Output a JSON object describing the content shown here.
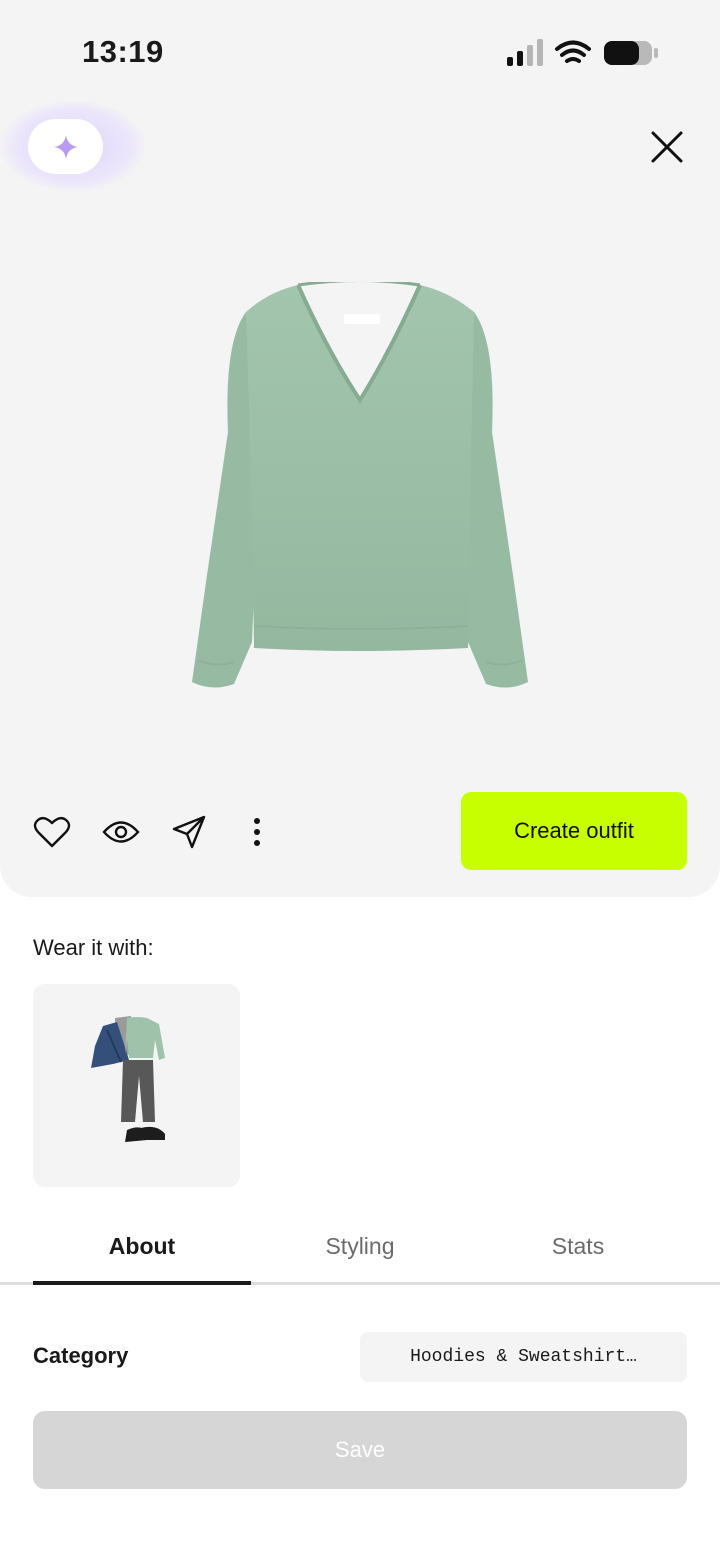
{
  "status_bar": {
    "time": "13:19",
    "icons": [
      "signal-icon",
      "wifi-icon",
      "battery-icon"
    ]
  },
  "header": {
    "ai_button_icon": "sparkle-icon",
    "close_icon": "close-icon"
  },
  "product": {
    "image": "green-v-neck-sweater",
    "color": "#9dbfa8"
  },
  "actions": {
    "icons": [
      "heart-icon",
      "eye-icon",
      "send-icon",
      "more-vertical-icon"
    ],
    "create_outfit_label": "Create outfit",
    "accent_color": "#c8ff00"
  },
  "wear_it_with": {
    "label": "Wear it with:",
    "outfits": [
      {
        "items": [
          "denim-jacket",
          "grey-top",
          "green-sweater",
          "grey-trousers",
          "black-sneakers"
        ]
      }
    ]
  },
  "tabs": [
    {
      "label": "About",
      "active": true
    },
    {
      "label": "Styling",
      "active": false
    },
    {
      "label": "Stats",
      "active": false
    }
  ],
  "about": {
    "category_label": "Category",
    "category_value": "Hoodies & Sweatshirt…"
  },
  "save_label": "Save"
}
